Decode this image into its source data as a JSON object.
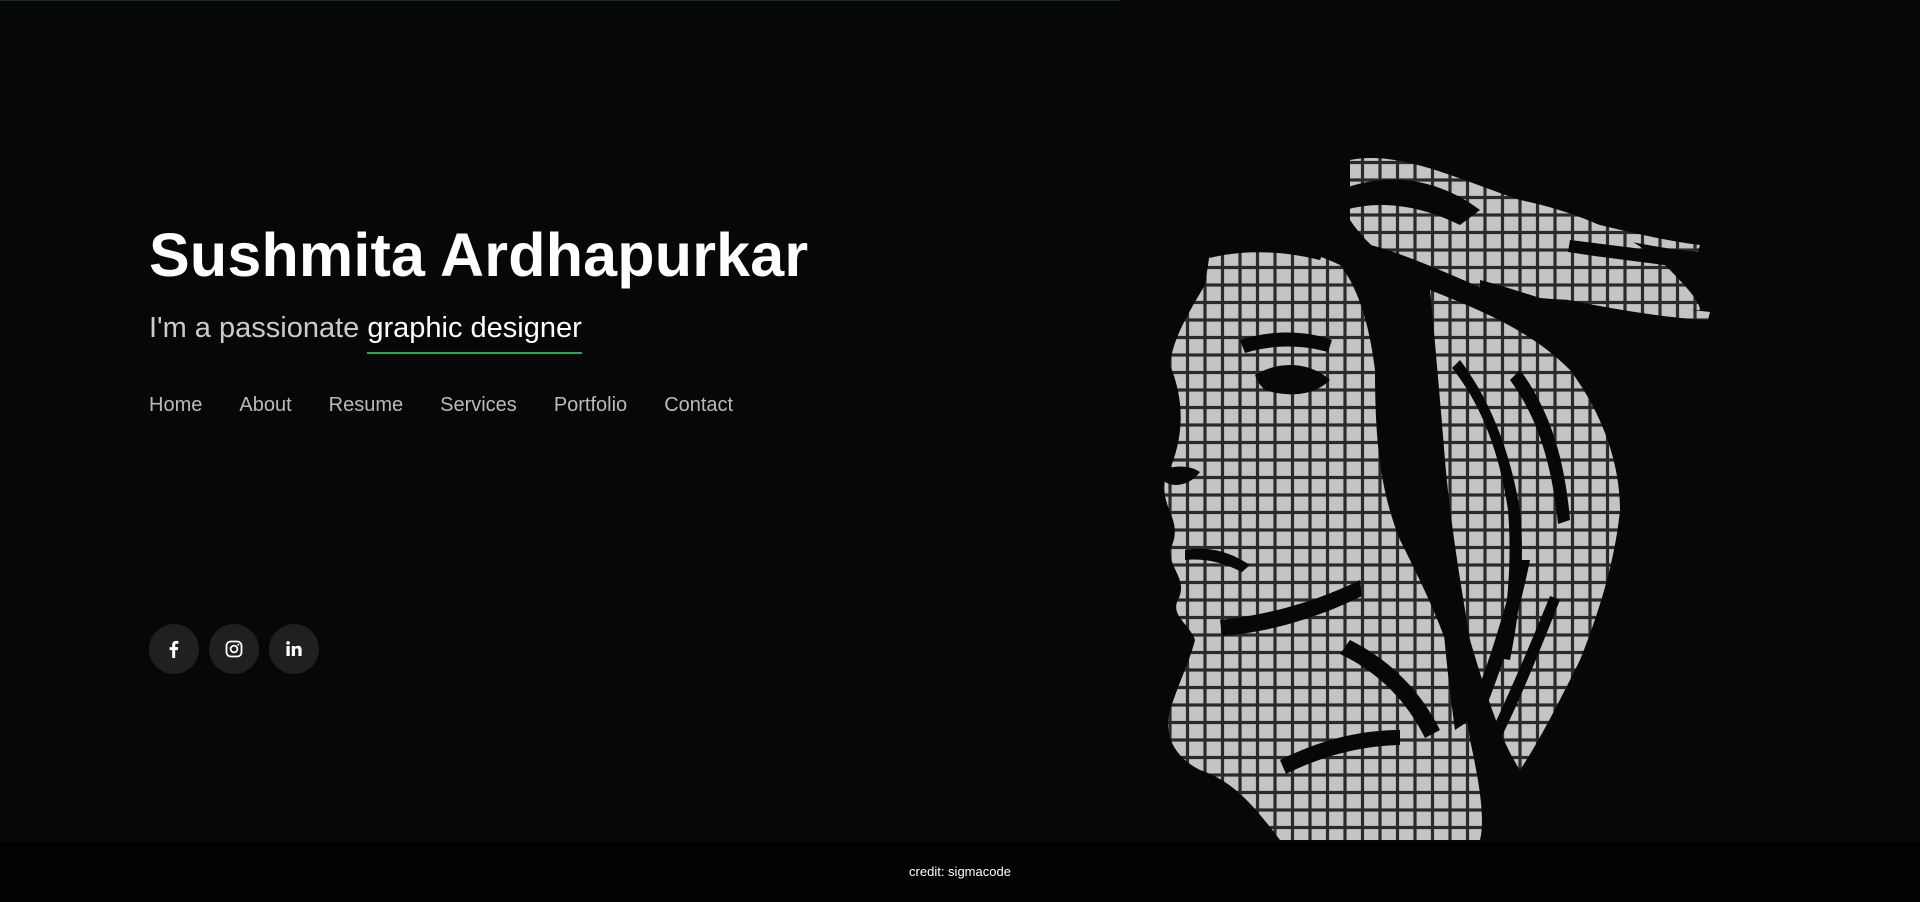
{
  "hero": {
    "name": "Sushmita Ardhapurkar",
    "subtitle_prefix": "I'm a passionate",
    "subtitle_highlight": "graphic designer",
    "accent_color": "#1fab4f"
  },
  "nav": {
    "items": [
      {
        "label": "Home"
      },
      {
        "label": "About"
      },
      {
        "label": "Resume"
      },
      {
        "label": "Services"
      },
      {
        "label": "Portfolio"
      },
      {
        "label": "Contact"
      }
    ]
  },
  "social": {
    "icons": [
      "facebook-icon",
      "instagram-icon",
      "linkedin-icon"
    ]
  },
  "illustration": {
    "icon": "woman-profile-grid-portrait"
  },
  "footer": {
    "credit": "credit: sigmacode"
  },
  "colors": {
    "background": "#060807",
    "grid_cells": "#c4c4c4",
    "social_button": "#1e2120"
  }
}
